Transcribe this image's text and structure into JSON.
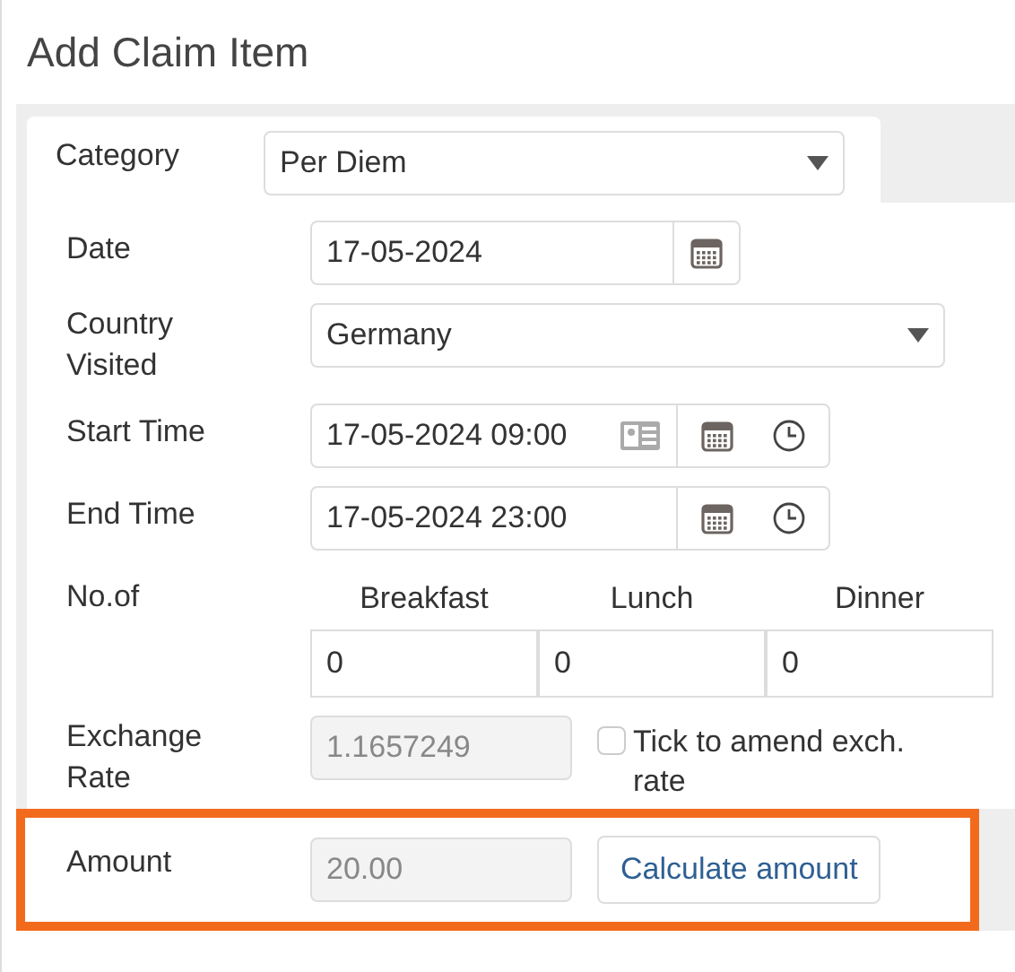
{
  "title": "Add Claim Item",
  "category": {
    "label": "Category",
    "value": "Per Diem"
  },
  "date": {
    "label": "Date",
    "value": "17-05-2024"
  },
  "country": {
    "label": "Country Visited",
    "value": "Germany"
  },
  "start_time": {
    "label": "Start Time",
    "value": "17-05-2024 09:00"
  },
  "end_time": {
    "label": "End Time",
    "value": "17-05-2024 23:00"
  },
  "meals": {
    "label": "No.of",
    "columns": [
      {
        "label": "Breakfast",
        "value": "0"
      },
      {
        "label": "Lunch",
        "value": "0"
      },
      {
        "label": "Dinner",
        "value": "0"
      }
    ]
  },
  "exchange_rate": {
    "label": "Exchange Rate",
    "value": "1.1657249",
    "disabled": true
  },
  "amend_checkbox": {
    "label": "Tick to amend exch. rate",
    "checked": false
  },
  "amount": {
    "label": "Amount",
    "value": "20.00",
    "disabled": true
  },
  "calculate_button": {
    "label": "Calculate amount"
  }
}
